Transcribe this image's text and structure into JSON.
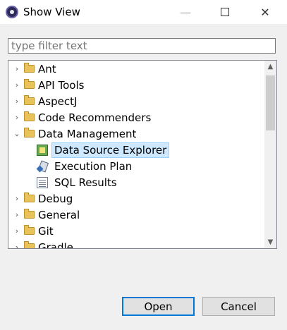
{
  "window": {
    "title": "Show View",
    "minimize_glyph": "—",
    "close_glyph": "✕"
  },
  "filter": {
    "placeholder": "type filter text",
    "value": ""
  },
  "tree": {
    "items": [
      {
        "label": "Ant",
        "type": "folder",
        "expanded": false
      },
      {
        "label": "API Tools",
        "type": "folder",
        "expanded": false
      },
      {
        "label": "AspectJ",
        "type": "folder",
        "expanded": false
      },
      {
        "label": "Code Recommenders",
        "type": "folder",
        "expanded": false
      },
      {
        "label": "Data Management",
        "type": "folder",
        "expanded": true
      },
      {
        "label": "Data Source Explorer",
        "type": "view",
        "icon": "data-source-explorer-icon",
        "selected": true
      },
      {
        "label": "Execution Plan",
        "type": "view",
        "icon": "execution-plan-icon"
      },
      {
        "label": "SQL Results",
        "type": "view",
        "icon": "sql-results-icon"
      },
      {
        "label": "Debug",
        "type": "folder",
        "expanded": false
      },
      {
        "label": "General",
        "type": "folder",
        "expanded": false
      },
      {
        "label": "Git",
        "type": "folder",
        "expanded": false
      },
      {
        "label": "Gradle",
        "type": "folder",
        "expanded": false
      }
    ],
    "arrow_collapsed": "›",
    "arrow_expanded": "⌄"
  },
  "buttons": {
    "open": "Open",
    "cancel": "Cancel"
  },
  "colors": {
    "selection_bg": "#cde8ff",
    "default_button_border": "#0078d7",
    "folder": "#e9c25a"
  }
}
